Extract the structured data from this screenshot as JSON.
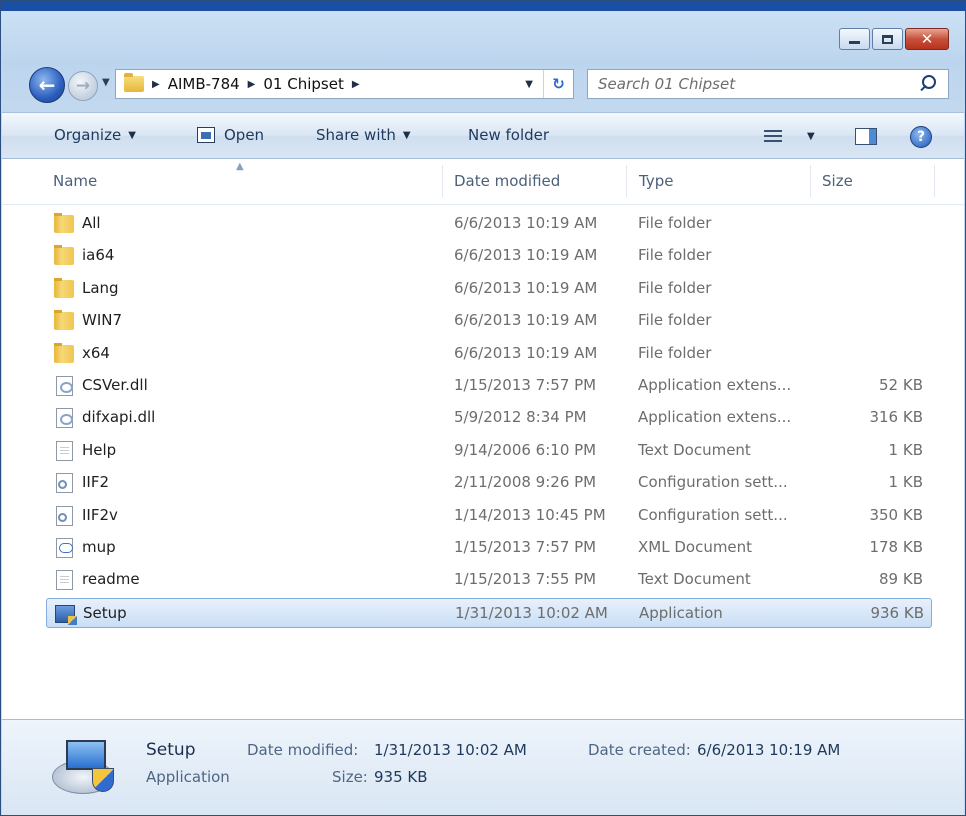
{
  "navigation": {
    "breadcrumbs": [
      "AIMB-784",
      "01 Chipset"
    ],
    "search_placeholder": "Search 01 Chipset",
    "back_icon": "back-arrow-icon",
    "forward_icon": "forward-arrow-icon",
    "refresh_icon": "refresh-icon"
  },
  "toolbar": {
    "organize": "Organize",
    "open": "Open",
    "share_with": "Share with",
    "new_folder": "New folder"
  },
  "columns": {
    "name": "Name",
    "date_modified": "Date modified",
    "type": "Type",
    "size": "Size"
  },
  "files": [
    {
      "name": "All",
      "date": "6/6/2013 10:19 AM",
      "type": "File folder",
      "size": "",
      "icon": "folder"
    },
    {
      "name": "ia64",
      "date": "6/6/2013 10:19 AM",
      "type": "File folder",
      "size": "",
      "icon": "folder"
    },
    {
      "name": "Lang",
      "date": "6/6/2013 10:19 AM",
      "type": "File folder",
      "size": "",
      "icon": "folder"
    },
    {
      "name": "WIN7",
      "date": "6/6/2013 10:19 AM",
      "type": "File folder",
      "size": "",
      "icon": "folder"
    },
    {
      "name": "x64",
      "date": "6/6/2013 10:19 AM",
      "type": "File folder",
      "size": "",
      "icon": "folder"
    },
    {
      "name": "CSVer.dll",
      "date": "1/15/2013 7:57 PM",
      "type": "Application extens...",
      "size": "52 KB",
      "icon": "dll"
    },
    {
      "name": "difxapi.dll",
      "date": "5/9/2012 8:34 PM",
      "type": "Application extens...",
      "size": "316 KB",
      "icon": "dll"
    },
    {
      "name": "Help",
      "date": "9/14/2006 6:10 PM",
      "type": "Text Document",
      "size": "1 KB",
      "icon": "text"
    },
    {
      "name": "IIF2",
      "date": "2/11/2008 9:26 PM",
      "type": "Configuration sett...",
      "size": "1 KB",
      "icon": "config"
    },
    {
      "name": "IIF2v",
      "date": "1/14/2013 10:45 PM",
      "type": "Configuration sett...",
      "size": "350 KB",
      "icon": "config"
    },
    {
      "name": "mup",
      "date": "1/15/2013 7:57 PM",
      "type": "XML Document",
      "size": "178 KB",
      "icon": "xml"
    },
    {
      "name": "readme",
      "date": "1/15/2013 7:55 PM",
      "type": "Text Document",
      "size": "89 KB",
      "icon": "text"
    },
    {
      "name": "Setup",
      "date": "1/31/2013 10:02 AM",
      "type": "Application",
      "size": "936 KB",
      "icon": "app",
      "selected": true
    }
  ],
  "details": {
    "name": "Setup",
    "type": "Application",
    "date_modified_label": "Date modified:",
    "date_modified": "1/31/2013 10:02 AM",
    "size_label": "Size:",
    "size": "935 KB",
    "date_created_label": "Date created:",
    "date_created": "6/6/2013 10:19 AM"
  },
  "colors": {
    "selection_border": "#84acdd",
    "window_frame": "#1a4fa3"
  }
}
